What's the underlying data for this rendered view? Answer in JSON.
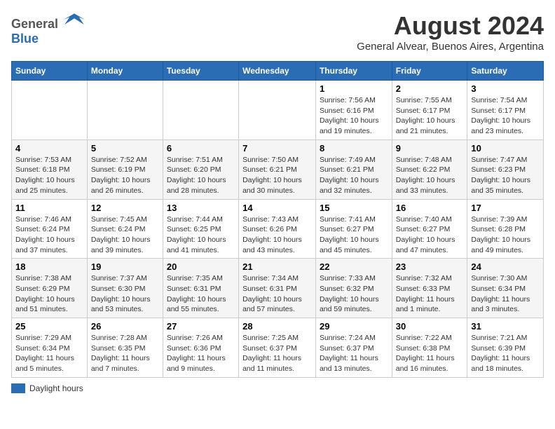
{
  "header": {
    "logo_general": "General",
    "logo_blue": "Blue",
    "month_year": "August 2024",
    "location": "General Alvear, Buenos Aires, Argentina"
  },
  "days_of_week": [
    "Sunday",
    "Monday",
    "Tuesday",
    "Wednesday",
    "Thursday",
    "Friday",
    "Saturday"
  ],
  "weeks": [
    [
      {
        "day": "",
        "info": ""
      },
      {
        "day": "",
        "info": ""
      },
      {
        "day": "",
        "info": ""
      },
      {
        "day": "",
        "info": ""
      },
      {
        "day": "1",
        "info": "Sunrise: 7:56 AM\nSunset: 6:16 PM\nDaylight: 10 hours\nand 19 minutes."
      },
      {
        "day": "2",
        "info": "Sunrise: 7:55 AM\nSunset: 6:17 PM\nDaylight: 10 hours\nand 21 minutes."
      },
      {
        "day": "3",
        "info": "Sunrise: 7:54 AM\nSunset: 6:17 PM\nDaylight: 10 hours\nand 23 minutes."
      }
    ],
    [
      {
        "day": "4",
        "info": "Sunrise: 7:53 AM\nSunset: 6:18 PM\nDaylight: 10 hours\nand 25 minutes."
      },
      {
        "day": "5",
        "info": "Sunrise: 7:52 AM\nSunset: 6:19 PM\nDaylight: 10 hours\nand 26 minutes."
      },
      {
        "day": "6",
        "info": "Sunrise: 7:51 AM\nSunset: 6:20 PM\nDaylight: 10 hours\nand 28 minutes."
      },
      {
        "day": "7",
        "info": "Sunrise: 7:50 AM\nSunset: 6:21 PM\nDaylight: 10 hours\nand 30 minutes."
      },
      {
        "day": "8",
        "info": "Sunrise: 7:49 AM\nSunset: 6:21 PM\nDaylight: 10 hours\nand 32 minutes."
      },
      {
        "day": "9",
        "info": "Sunrise: 7:48 AM\nSunset: 6:22 PM\nDaylight: 10 hours\nand 33 minutes."
      },
      {
        "day": "10",
        "info": "Sunrise: 7:47 AM\nSunset: 6:23 PM\nDaylight: 10 hours\nand 35 minutes."
      }
    ],
    [
      {
        "day": "11",
        "info": "Sunrise: 7:46 AM\nSunset: 6:24 PM\nDaylight: 10 hours\nand 37 minutes."
      },
      {
        "day": "12",
        "info": "Sunrise: 7:45 AM\nSunset: 6:24 PM\nDaylight: 10 hours\nand 39 minutes."
      },
      {
        "day": "13",
        "info": "Sunrise: 7:44 AM\nSunset: 6:25 PM\nDaylight: 10 hours\nand 41 minutes."
      },
      {
        "day": "14",
        "info": "Sunrise: 7:43 AM\nSunset: 6:26 PM\nDaylight: 10 hours\nand 43 minutes."
      },
      {
        "day": "15",
        "info": "Sunrise: 7:41 AM\nSunset: 6:27 PM\nDaylight: 10 hours\nand 45 minutes."
      },
      {
        "day": "16",
        "info": "Sunrise: 7:40 AM\nSunset: 6:27 PM\nDaylight: 10 hours\nand 47 minutes."
      },
      {
        "day": "17",
        "info": "Sunrise: 7:39 AM\nSunset: 6:28 PM\nDaylight: 10 hours\nand 49 minutes."
      }
    ],
    [
      {
        "day": "18",
        "info": "Sunrise: 7:38 AM\nSunset: 6:29 PM\nDaylight: 10 hours\nand 51 minutes."
      },
      {
        "day": "19",
        "info": "Sunrise: 7:37 AM\nSunset: 6:30 PM\nDaylight: 10 hours\nand 53 minutes."
      },
      {
        "day": "20",
        "info": "Sunrise: 7:35 AM\nSunset: 6:31 PM\nDaylight: 10 hours\nand 55 minutes."
      },
      {
        "day": "21",
        "info": "Sunrise: 7:34 AM\nSunset: 6:31 PM\nDaylight: 10 hours\nand 57 minutes."
      },
      {
        "day": "22",
        "info": "Sunrise: 7:33 AM\nSunset: 6:32 PM\nDaylight: 10 hours\nand 59 minutes."
      },
      {
        "day": "23",
        "info": "Sunrise: 7:32 AM\nSunset: 6:33 PM\nDaylight: 11 hours\nand 1 minute."
      },
      {
        "day": "24",
        "info": "Sunrise: 7:30 AM\nSunset: 6:34 PM\nDaylight: 11 hours\nand 3 minutes."
      }
    ],
    [
      {
        "day": "25",
        "info": "Sunrise: 7:29 AM\nSunset: 6:34 PM\nDaylight: 11 hours\nand 5 minutes."
      },
      {
        "day": "26",
        "info": "Sunrise: 7:28 AM\nSunset: 6:35 PM\nDaylight: 11 hours\nand 7 minutes."
      },
      {
        "day": "27",
        "info": "Sunrise: 7:26 AM\nSunset: 6:36 PM\nDaylight: 11 hours\nand 9 minutes."
      },
      {
        "day": "28",
        "info": "Sunrise: 7:25 AM\nSunset: 6:37 PM\nDaylight: 11 hours\nand 11 minutes."
      },
      {
        "day": "29",
        "info": "Sunrise: 7:24 AM\nSunset: 6:37 PM\nDaylight: 11 hours\nand 13 minutes."
      },
      {
        "day": "30",
        "info": "Sunrise: 7:22 AM\nSunset: 6:38 PM\nDaylight: 11 hours\nand 16 minutes."
      },
      {
        "day": "31",
        "info": "Sunrise: 7:21 AM\nSunset: 6:39 PM\nDaylight: 11 hours\nand 18 minutes."
      }
    ]
  ],
  "legend": {
    "daylight_hours": "Daylight hours"
  }
}
